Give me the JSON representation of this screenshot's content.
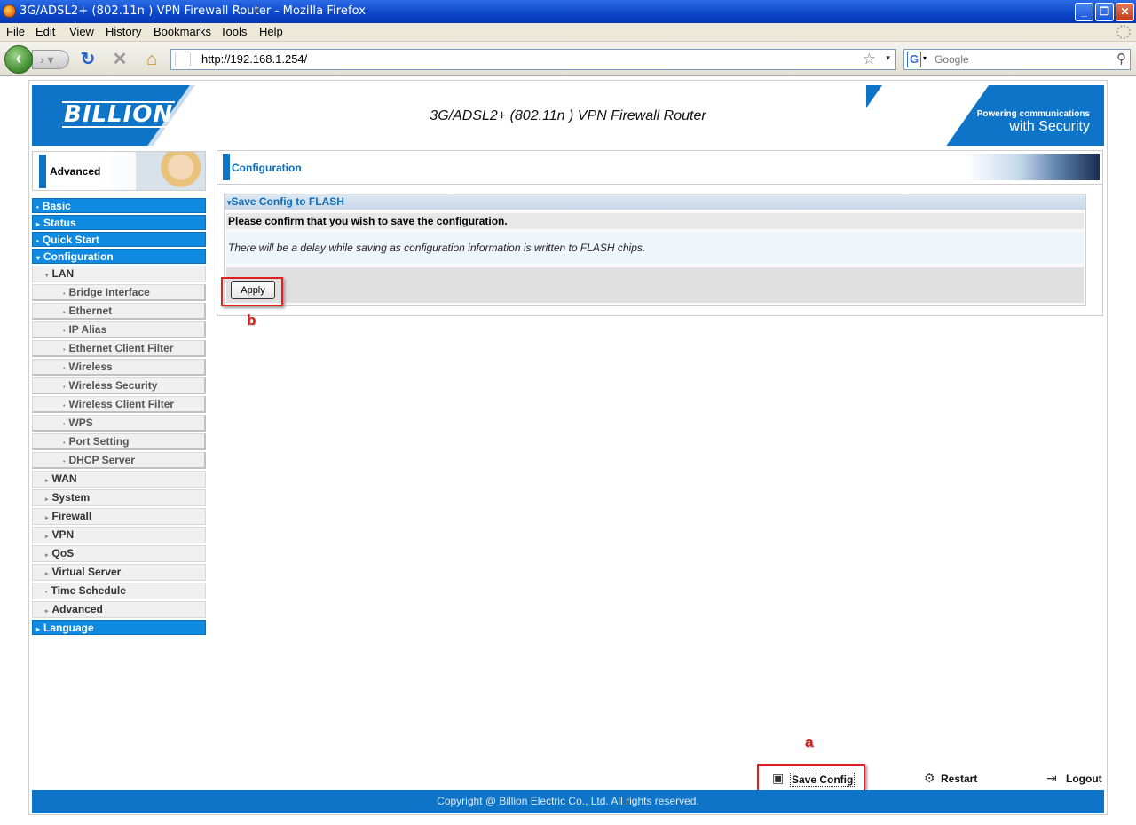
{
  "window": {
    "title": "3G/ADSL2+ (802.11n ) VPN Firewall Router - Mozilla Firefox",
    "minimize": "_",
    "restore": "❐",
    "close": "✕"
  },
  "menubar": [
    "File",
    "Edit",
    "View",
    "History",
    "Bookmarks",
    "Tools",
    "Help"
  ],
  "navbar": {
    "url": "http://192.168.1.254/",
    "search_placeholder": "Google"
  },
  "banner": {
    "logo": "BILLION",
    "title": "3G/ADSL2+ (802.11n ) VPN Firewall Router",
    "tagline_top": "Powering communications",
    "tagline_bottom": "with Security"
  },
  "sidebar": {
    "header": "Advanced",
    "items": [
      {
        "label": "Basic",
        "level": "top"
      },
      {
        "label": "Status",
        "level": "top"
      },
      {
        "label": "Quick Start",
        "level": "top"
      },
      {
        "label": "Configuration",
        "level": "top"
      },
      {
        "label": "LAN",
        "level": "sub"
      },
      {
        "label": "Bridge Interface",
        "level": "sub2"
      },
      {
        "label": "Ethernet",
        "level": "sub2"
      },
      {
        "label": "IP Alias",
        "level": "sub2"
      },
      {
        "label": "Ethernet Client Filter",
        "level": "sub2"
      },
      {
        "label": "Wireless",
        "level": "sub2"
      },
      {
        "label": "Wireless Security",
        "level": "sub2"
      },
      {
        "label": "Wireless Client Filter",
        "level": "sub2"
      },
      {
        "label": "WPS",
        "level": "sub2"
      },
      {
        "label": "Port Setting",
        "level": "sub2"
      },
      {
        "label": "DHCP Server",
        "level": "sub2"
      },
      {
        "label": "WAN",
        "level": "sub"
      },
      {
        "label": "System",
        "level": "sub"
      },
      {
        "label": "Firewall",
        "level": "sub"
      },
      {
        "label": "VPN",
        "level": "sub"
      },
      {
        "label": "QoS",
        "level": "sub"
      },
      {
        "label": "Virtual Server",
        "level": "sub"
      },
      {
        "label": "Time Schedule",
        "level": "sub"
      },
      {
        "label": "Advanced",
        "level": "sub"
      },
      {
        "label": "Language",
        "level": "top"
      }
    ]
  },
  "content": {
    "header": "Configuration",
    "section_title": "Save Config to FLASH",
    "confirm_text": "Please confirm that you wish to save the configuration.",
    "delay_text": "There will be a delay while saving as configuration information is written to FLASH chips.",
    "apply_label": "Apply"
  },
  "annotations": {
    "a": "a",
    "b": "b"
  },
  "bottom_links": {
    "save_config": "Save Config",
    "restart": "Restart",
    "logout": "Logout"
  },
  "footer": "Copyright @ Billion Electric Co., Ltd. All rights reserved.",
  "colors": {
    "brand_blue": "#0e74c8",
    "menu_blue": "#0e8be0",
    "annotation_red": "#e02020"
  }
}
